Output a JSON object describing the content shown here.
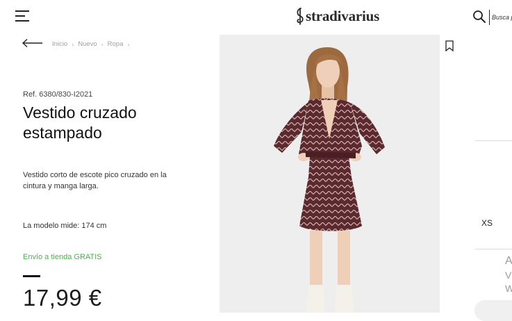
{
  "header": {
    "logo_text": "stradivarius",
    "search_placeholder": "Busca p"
  },
  "breadcrumb": [
    "Inicio",
    "Nuevo",
    "Ropa"
  ],
  "product": {
    "ref": "Ref. 6380/830-I2021",
    "title_line1": "Vestido cruzado",
    "title_line2": "estampado",
    "description": "Vestido corto de escote pico cruzado en la cintura y manga larga.",
    "model_info": "La modelo mide: 174 cm",
    "shipping": "Envío a tienda GRATIS",
    "price": "17,99 €"
  },
  "sizes": [
    "XS"
  ],
  "right_fragments": [
    "A",
    "V",
    "W"
  ],
  "colors": {
    "shipping_green": "#4caf50",
    "photo_background": "#eeeeee",
    "dress_burgundy": "#5a2a2e"
  },
  "icons": {
    "menu": "hamburger-icon",
    "search": "search-icon",
    "back": "arrow-left-icon",
    "wishlist": "bookmark-icon"
  }
}
